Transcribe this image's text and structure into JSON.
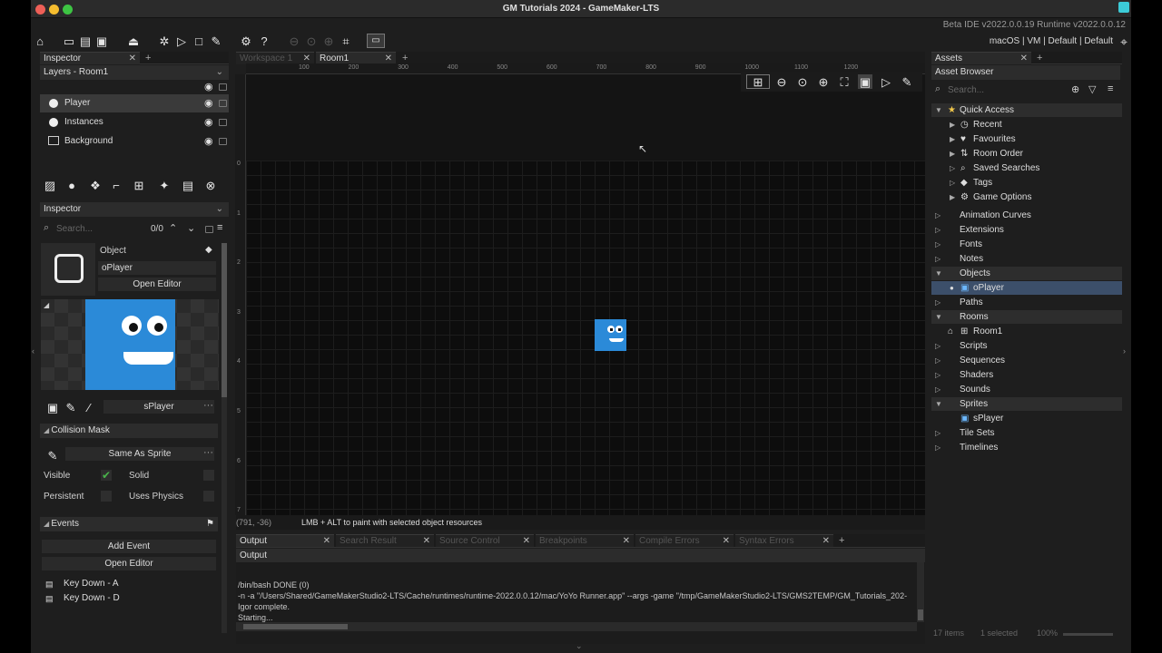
{
  "window": {
    "title": "GM Tutorials 2024 - GameMaker-LTS",
    "version": "Beta IDE v2022.0.0.19  Runtime v2022.0.0.12",
    "target": "macOS | VM | Default | Default"
  },
  "left_tabs": {
    "inspector": "Inspector"
  },
  "layers": {
    "header": "Layers - Room1",
    "items": [
      {
        "label": "Player"
      },
      {
        "label": "Instances"
      },
      {
        "label": "Background"
      }
    ]
  },
  "inspector": {
    "header": "Inspector",
    "search_placeholder": "Search...",
    "count": "0/0",
    "object_label": "Object",
    "object_name": "oPlayer",
    "open_editor": "Open Editor",
    "sprite_name": "sPlayer",
    "collision_mask_header": "Collision Mask",
    "collision_mask_value": "Same As Sprite",
    "visible_label": "Visible",
    "solid_label": "Solid",
    "persistent_label": "Persistent",
    "uses_physics_label": "Uses Physics",
    "visible_checked": true,
    "events_header": "Events",
    "add_event": "Add Event",
    "open_editor_events": "Open Editor",
    "events": [
      "Key Down - A",
      "Key Down - D"
    ]
  },
  "editor_tabs": {
    "workspace": "Workspace 1",
    "room": "Room1"
  },
  "ruler": {
    "h": [
      "100",
      "200",
      "300",
      "400",
      "500",
      "600",
      "700",
      "800",
      "900",
      "1000",
      "1100",
      "1200"
    ],
    "v": [
      "0",
      "1",
      "2",
      "3",
      "4",
      "5",
      "6",
      "7"
    ]
  },
  "status": {
    "coords": "(791, -36)",
    "hint": "LMB + ALT to paint with selected object resources"
  },
  "output": {
    "tabs": [
      "Output",
      "Search Result",
      "Source Control",
      "Breakpoints",
      "Compile Errors",
      "Syntax Errors"
    ],
    "header": "Output",
    "lines": [
      "/bin/bash DONE (0)",
      "-n -a \"/Users/Shared/GameMakerStudio2-LTS/Cache/runtimes/runtime-2022.0.0.12/mac/YoYo Runner.app\" --args -game \"/tmp/GameMakerStudio2-LTS/GMS2TEMP/GM_Tutorials_202-",
      "Igor complete.",
      "Starting..."
    ]
  },
  "assets": {
    "tab": "Assets",
    "header": "Asset Browser",
    "search_placeholder": "Search...",
    "quick_access": "Quick Access",
    "quick_items": [
      "Recent",
      "Favourites",
      "Room Order",
      "Saved Searches",
      "Tags",
      "Game Options"
    ],
    "groups": [
      "Animation Curves",
      "Extensions",
      "Fonts",
      "Notes",
      "Objects",
      "oPlayer",
      "Paths",
      "Rooms",
      "Room1",
      "Scripts",
      "Sequences",
      "Shaders",
      "Sounds",
      "Sprites",
      "sPlayer",
      "Tile Sets",
      "Timelines"
    ],
    "footer_count": "17 items",
    "footer_selected": "1 selected",
    "footer_zoom": "100%"
  },
  "colors": {
    "accent": "#3c4f6a",
    "player_blue": "#2b8ad8",
    "traffic_red": "#ee5f57",
    "traffic_yellow": "#f5bd2f",
    "traffic_green": "#3dc443"
  }
}
